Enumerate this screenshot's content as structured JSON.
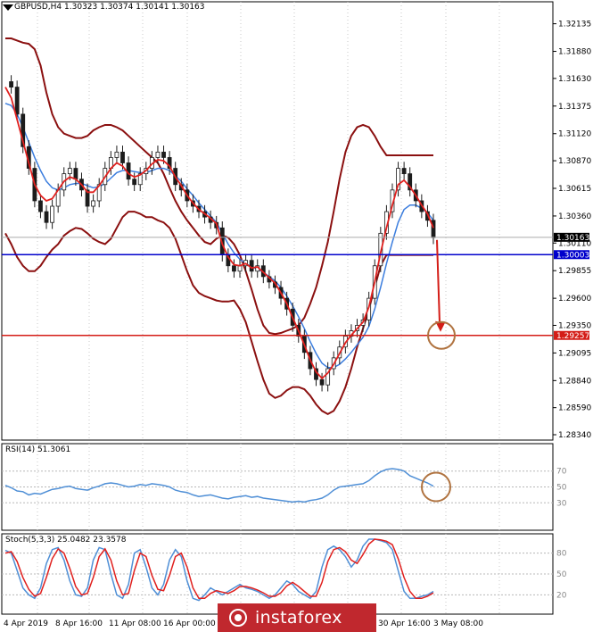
{
  "header": {
    "symbol": "GBPUSD,H4",
    "ohlc": "1.30323 1.30374 1.30141 1.30163"
  },
  "indicators": {
    "rsi_label": "RSI(14) 51.3061",
    "stoch_label": "Stoch(5,3,3) 25.0482 23.3578"
  },
  "watermark": {
    "text": "instaforex"
  },
  "colors": {
    "price_line": "#1c1c1c",
    "ma_fast": "#e0201e",
    "ma_slow": "#3b7dde",
    "bands": "#8b1010",
    "support_blue": "#0000cc",
    "target_red": "#d41d17",
    "rsi_line": "#4f8fd6",
    "stoch_main": "#4f8fd6",
    "stoch_signal": "#e0201e",
    "circle": "#b07340",
    "badge_current": "#000000",
    "badge_blue": "#0000cc",
    "badge_red": "#d41d17",
    "watermark_bg": "#c0282e"
  },
  "chart_data": [
    {
      "type": "line",
      "panel": "price",
      "ylim": [
        1.2834,
        1.3214
      ],
      "y_ticks": [
        "1.32135",
        "1.31880",
        "1.31630",
        "1.31375",
        "1.31120",
        "1.30870",
        "1.30615",
        "1.30360",
        "1.30110",
        "1.29855",
        "1.29600",
        "1.29350",
        "1.29095",
        "1.28840",
        "1.28590",
        "1.28340"
      ],
      "x_tick_labels": [
        "4 Apr 2019",
        "8 Apr 16:00",
        "11 Apr 08:00",
        "16 Apr 00:00",
        "30 Apr 16:00",
        "3 May 08:00"
      ],
      "current_price": "1.30163",
      "levels": [
        {
          "label": "1.30003",
          "value": 1.30003,
          "color": "#0000cc"
        },
        {
          "label": "1.29257",
          "value": 1.29257,
          "color": "#d41d17"
        }
      ],
      "series": [
        {
          "values": [
            1.316,
            1.3155,
            1.313,
            1.31,
            1.308,
            1.305,
            1.304,
            1.303,
            1.3045,
            1.306,
            1.3075,
            1.308,
            1.307,
            1.306,
            1.3045,
            1.305,
            1.3065,
            1.308,
            1.309,
            1.3095,
            1.3085,
            1.307,
            1.3065,
            1.3075,
            1.308,
            1.309,
            1.3095,
            1.309,
            1.308,
            1.3065,
            1.306,
            1.305,
            1.3045,
            1.304,
            1.3035,
            1.303,
            1.3025,
            1.3,
            1.299,
            1.2985,
            1.299,
            1.2995,
            1.2985,
            1.299,
            1.298,
            1.2975,
            1.297,
            1.296,
            1.295,
            1.2935,
            1.2925,
            1.291,
            1.2895,
            1.2885,
            1.288,
            1.2895,
            1.2905,
            1.2915,
            1.2925,
            1.293,
            1.2935,
            1.294,
            1.296,
            1.299,
            1.302,
            1.304,
            1.306,
            1.308,
            1.3075,
            1.306,
            1.305,
            1.304,
            1.3032,
            1.3016
          ]
        },
        {
          "name": "",
          "values": [
            1.3155,
            1.3145,
            1.3125,
            1.3105,
            1.3085,
            1.3065,
            1.3055,
            1.305,
            1.3052,
            1.306,
            1.3068,
            1.3072,
            1.307,
            1.3065,
            1.3058,
            1.3058,
            1.3064,
            1.3072,
            1.308,
            1.3085,
            1.3082,
            1.3075,
            1.3072,
            1.3074,
            1.3078,
            1.3084,
            1.3088,
            1.3087,
            1.3082,
            1.3072,
            1.3064,
            1.3055,
            1.3048,
            1.3042,
            1.3038,
            1.3034,
            1.3029,
            1.301,
            1.2998,
            1.2991,
            1.299,
            1.2992,
            1.2988,
            1.2989,
            1.2984,
            1.2979,
            1.2974,
            1.2965,
            1.2955,
            1.2942,
            1.293,
            1.2917,
            1.2903,
            1.2892,
            1.2886,
            1.2891,
            1.2899,
            1.2909,
            1.2919,
            1.2926,
            1.2932,
            1.2938,
            1.2952,
            1.2975,
            1.3002,
            1.3025,
            1.3046,
            1.3065,
            1.3069,
            1.3063,
            1.3055,
            1.3046,
            1.3038,
            1.3025
          ]
        },
        {
          "name": "",
          "values": [
            1.314,
            1.3138,
            1.313,
            1.3118,
            1.3104,
            1.309,
            1.3078,
            1.3068,
            1.3062,
            1.306,
            1.3062,
            1.3065,
            1.3066,
            1.3066,
            1.3064,
            1.3062,
            1.3063,
            1.3066,
            1.3071,
            1.3076,
            1.3078,
            1.3078,
            1.3077,
            1.3076,
            1.3076,
            1.3078,
            1.308,
            1.308,
            1.3078,
            1.3073,
            1.3068,
            1.3061,
            1.3055,
            1.3048,
            1.3042,
            1.3036,
            1.303,
            1.302,
            1.301,
            1.3002,
            1.2996,
            1.2992,
            1.2989,
            1.2987,
            1.2984,
            1.298,
            1.2976,
            1.297,
            1.2962,
            1.2953,
            1.2943,
            1.2932,
            1.292,
            1.2909,
            1.29,
            1.2896,
            1.2896,
            1.2899,
            1.2904,
            1.291,
            1.2917,
            1.2924,
            1.2934,
            1.295,
            1.297,
            1.2992,
            1.3012,
            1.303,
            1.3042,
            1.3046,
            1.3046,
            1.3043,
            1.3039,
            1.3032
          ]
        },
        {
          "name": "",
          "values": [
            1.32,
            1.32,
            1.3198,
            1.3196,
            1.3195,
            1.319,
            1.3175,
            1.315,
            1.313,
            1.3118,
            1.3112,
            1.311,
            1.3108,
            1.3108,
            1.311,
            1.3115,
            1.3118,
            1.312,
            1.312,
            1.3118,
            1.3115,
            1.311,
            1.3105,
            1.31,
            1.3095,
            1.309,
            1.3085,
            1.3075,
            1.3062,
            1.305,
            1.304,
            1.3032,
            1.3025,
            1.3018,
            1.3012,
            1.301,
            1.3015,
            1.3018,
            1.3016,
            1.301,
            1.3,
            1.2985,
            1.2968,
            1.295,
            1.2935,
            1.2928,
            1.2927,
            1.2928,
            1.293,
            1.2932,
            1.2935,
            1.2942,
            1.2955,
            1.297,
            1.299,
            1.3012,
            1.304,
            1.307,
            1.3095,
            1.311,
            1.3118,
            1.312,
            1.3118,
            1.311,
            1.31,
            1.3092,
            1.3092,
            1.3092,
            1.3092,
            1.3092,
            1.3092,
            1.3092,
            1.3092,
            1.3092
          ]
        },
        {
          "name": "",
          "values": [
            1.302,
            1.301,
            1.2998,
            1.299,
            1.2985,
            1.2985,
            1.299,
            1.2998,
            1.3005,
            1.301,
            1.3018,
            1.3022,
            1.3025,
            1.3024,
            1.302,
            1.3015,
            1.3012,
            1.301,
            1.3015,
            1.3025,
            1.3035,
            1.304,
            1.304,
            1.3038,
            1.3035,
            1.3035,
            1.3032,
            1.303,
            1.3025,
            1.3015,
            1.3,
            1.2985,
            1.2972,
            1.2965,
            1.2962,
            1.296,
            1.2958,
            1.2957,
            1.2957,
            1.2958,
            1.295,
            1.2938,
            1.292,
            1.2902,
            1.2885,
            1.2872,
            1.2868,
            1.287,
            1.2875,
            1.2878,
            1.2878,
            1.2876,
            1.287,
            1.2862,
            1.2856,
            1.2853,
            1.2856,
            1.2865,
            1.2878,
            1.2895,
            1.2915,
            1.2932,
            1.295,
            1.297,
            1.299,
            1.3,
            1.3,
            1.3,
            1.3,
            1.3,
            1.3,
            1.3,
            1.3,
            1.3
          ]
        }
      ]
    },
    {
      "type": "line",
      "panel": "rsi",
      "ylim": [
        0,
        100
      ],
      "levels": [
        "70",
        "50",
        "30"
      ],
      "series": [
        {
          "values": [
            52,
            49,
            45,
            44,
            40,
            42,
            41,
            44,
            47,
            48,
            50,
            51,
            48,
            47,
            46,
            49,
            51,
            54,
            55,
            54,
            52,
            50,
            51,
            53,
            52,
            54,
            53,
            52,
            50,
            46,
            44,
            43,
            40,
            38,
            39,
            40,
            38,
            36,
            35,
            37,
            38,
            39,
            37,
            38,
            36,
            35,
            34,
            33,
            32,
            31,
            32,
            31,
            33,
            34,
            36,
            40,
            46,
            50,
            51,
            52,
            53,
            54,
            58,
            64,
            69,
            72,
            73,
            72,
            70,
            64,
            61,
            58,
            55,
            51
          ]
        }
      ]
    },
    {
      "type": "line",
      "panel": "stochastic",
      "ylim": [
        0,
        100
      ],
      "levels": [
        "80",
        "50",
        "20"
      ],
      "series": [
        {
          "values": [
            84,
            80,
            55,
            30,
            20,
            15,
            30,
            65,
            85,
            88,
            70,
            40,
            20,
            18,
            30,
            70,
            88,
            85,
            50,
            20,
            15,
            35,
            80,
            85,
            60,
            30,
            20,
            35,
            70,
            85,
            75,
            40,
            15,
            12,
            20,
            30,
            25,
            20,
            25,
            30,
            35,
            30,
            28,
            25,
            20,
            15,
            20,
            30,
            40,
            35,
            25,
            20,
            15,
            25,
            60,
            85,
            90,
            85,
            75,
            60,
            70,
            90,
            100,
            100,
            98,
            95,
            85,
            55,
            25,
            15,
            15,
            18,
            20,
            25
          ]
        },
        {
          "values": [
            80,
            82,
            68,
            45,
            28,
            18,
            22,
            45,
            72,
            86,
            80,
            58,
            32,
            20,
            22,
            45,
            75,
            86,
            70,
            40,
            20,
            22,
            55,
            80,
            75,
            48,
            28,
            26,
            48,
            75,
            80,
            60,
            30,
            15,
            15,
            22,
            26,
            24,
            22,
            26,
            32,
            32,
            30,
            27,
            23,
            18,
            18,
            23,
            33,
            38,
            32,
            25,
            18,
            18,
            38,
            68,
            85,
            88,
            82,
            70,
            65,
            78,
            93,
            100,
            99,
            97,
            92,
            72,
            45,
            25,
            15,
            15,
            18,
            23
          ]
        }
      ]
    }
  ]
}
